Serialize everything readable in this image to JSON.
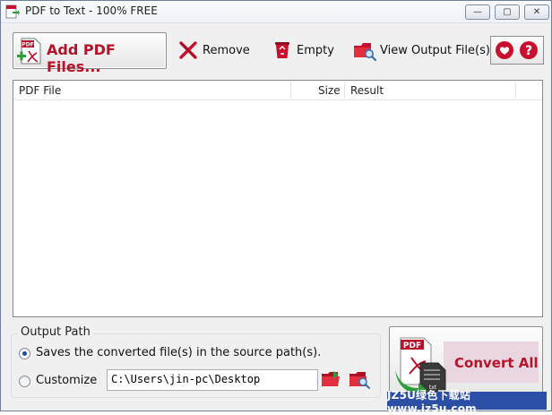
{
  "window": {
    "title": "PDF to Text - 100% FREE",
    "controls": {
      "minimize": "—",
      "maximize": "▢",
      "close": "✕"
    }
  },
  "toolbar": {
    "add_label": "Add PDF Files...",
    "add_icon": "pdf-add-icon",
    "remove_label": "Remove",
    "empty_label": "Empty",
    "view_label": "View Output File(s)",
    "pdf_badge": "PDF"
  },
  "file_list": {
    "columns": [
      "PDF File",
      "Size",
      "Result"
    ],
    "rows": []
  },
  "output_path": {
    "group_label": "Output Path",
    "option_source": "Saves the converted file(s) in the source path(s).",
    "option_customize": "Customize",
    "selected": "source",
    "path_value": "C:\\Users\\jin-pc\\Desktop"
  },
  "convert": {
    "label": "Convert All",
    "pdf_badge": "PDF",
    "txt_badge": "txt"
  },
  "watermark": {
    "text": "JZ5U绿色下载站 www.jz5u.com"
  },
  "colors": {
    "accent_red": "#b5132a",
    "watermark_blue": "#2c4fa6"
  }
}
